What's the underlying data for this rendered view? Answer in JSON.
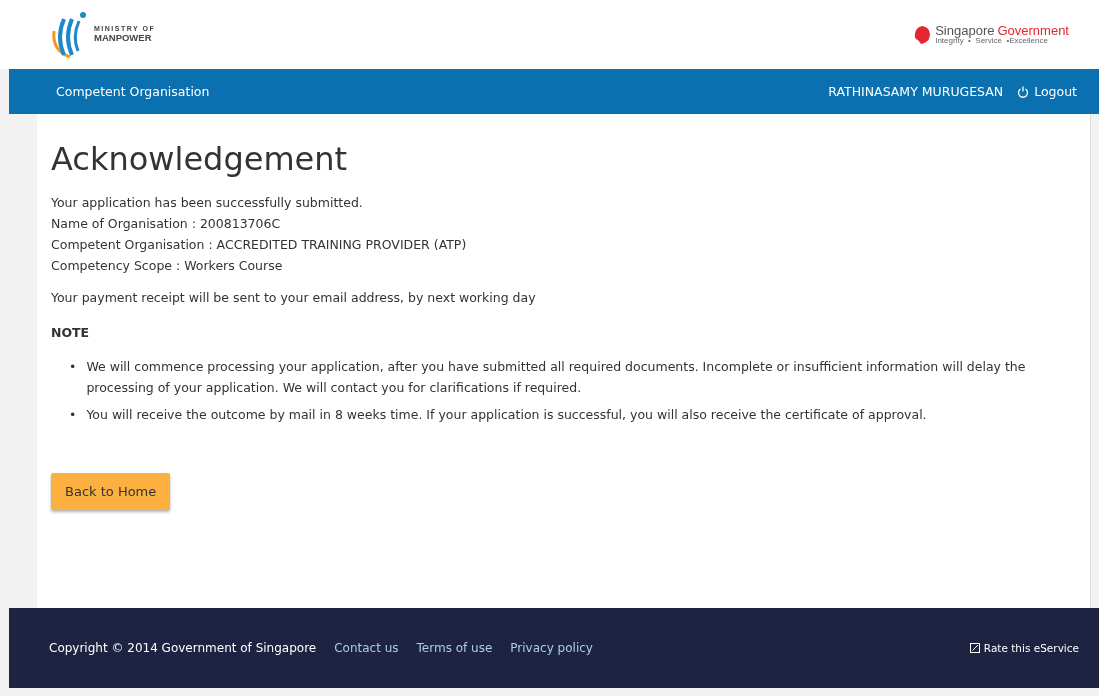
{
  "header": {
    "logo_line1": "MINISTRY OF",
    "logo_line2": "MANPOWER",
    "gov_name_1": "Singapore",
    "gov_name_2": "Government",
    "gov_tagline": "Integrity  •  Service  •Excellence"
  },
  "navbar": {
    "title": "Competent Organisation",
    "user": "RATHINASAMY MURUGESAN",
    "logout": "Logout"
  },
  "page": {
    "heading": "Acknowledgement",
    "details": [
      "Your application has been successfully submitted.",
      "Name of Organisation : 200813706C",
      "Competent Organisation : ACCREDITED TRAINING PROVIDER (ATP)",
      "Competency Scope : Workers Course"
    ],
    "receipt_note": "Your payment receipt will be sent to your email address, by next working day",
    "note_heading": "NOTE",
    "note_bullet": "•",
    "notes": [
      "We will commence processing your application, after you have submitted all required documents. Incomplete or insufficient information will delay the processing of your application. We will contact you for clarifications if required.",
      "You will receive the outcome by mail in 8 weeks time. If your application is successful, you will also receive the certificate of approval."
    ],
    "button": "Back to Home"
  },
  "footer": {
    "copyright": "Copyright © 2014 Government of Singapore",
    "links": [
      "Contact us",
      "Terms of use",
      "Privacy policy"
    ],
    "rate": "Rate this eService"
  }
}
